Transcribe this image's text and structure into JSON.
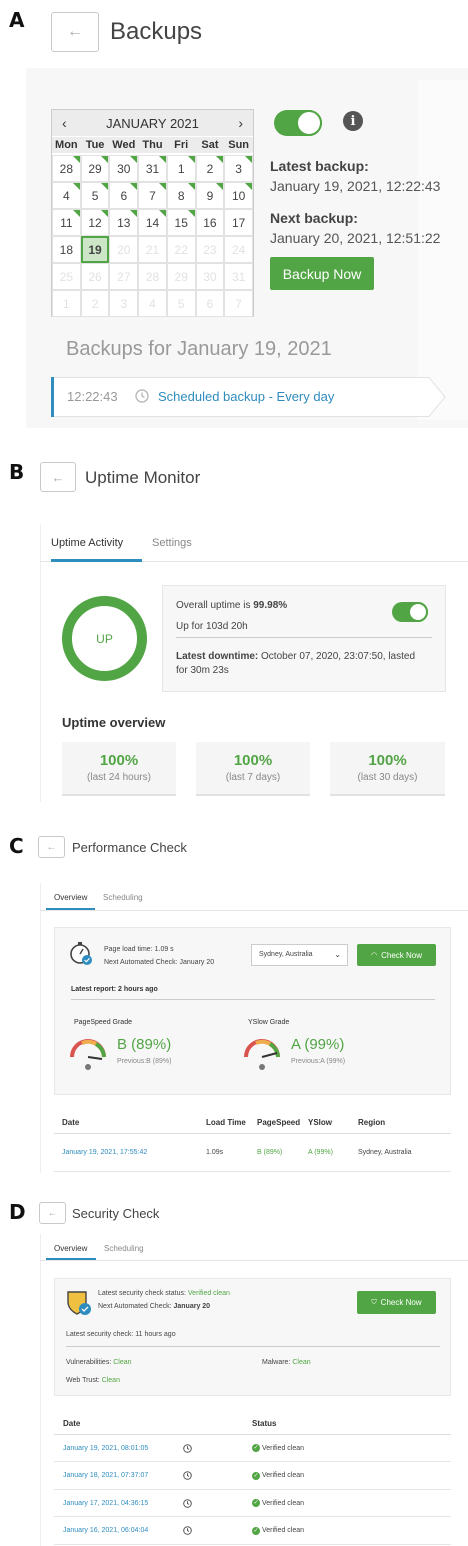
{
  "panels": {
    "a": {
      "letter": "A",
      "title": "Backups",
      "calendar": {
        "month_label": "JANUARY 2021",
        "prev": "‹",
        "next": "›",
        "weekdays": [
          "Mon",
          "Tue",
          "Wed",
          "Thu",
          "Fri",
          "Sat",
          "Sun"
        ],
        "days": [
          "28",
          "29",
          "30",
          "31",
          "1",
          "2",
          "3",
          "4",
          "5",
          "6",
          "7",
          "8",
          "9",
          "10",
          "11",
          "12",
          "13",
          "14",
          "15",
          "16",
          "17",
          "18",
          "19",
          "20",
          "21",
          "22",
          "23",
          "24",
          "25",
          "26",
          "27",
          "28",
          "29",
          "30",
          "31",
          "1",
          "2",
          "3",
          "4",
          "5",
          "6",
          "7"
        ],
        "selected_day": "19"
      },
      "latest_backup_label": "Latest backup:",
      "latest_backup_value": "January 19, 2021, 12:22:43",
      "next_backup_label": "Next backup:",
      "next_backup_value": "January 20, 2021, 12:51:22",
      "backup_now": "Backup Now",
      "backups_for": "Backups for January 19, 2021",
      "entry_time": "12:22:43",
      "entry_label": "Scheduled backup - Every day",
      "toggle_on": true
    },
    "b": {
      "letter": "B",
      "title": "Uptime Monitor",
      "tabs": [
        "Uptime Activity",
        "Settings"
      ],
      "status": "UP",
      "overall_prefix": "Overall uptime is ",
      "overall_value": "99.98%",
      "up_for": "Up for 103d 20h",
      "latest_downtime_label": "Latest downtime:",
      "latest_downtime_value": "October 07, 2020, 23:07:50, lasted for 30m 23s",
      "overview_title": "Uptime overview",
      "overview": [
        {
          "value": "100%",
          "label": "(last 24 hours)"
        },
        {
          "value": "100%",
          "label": "(last 7 days)"
        },
        {
          "value": "100%",
          "label": "(last 30 days)"
        }
      ]
    },
    "c": {
      "letter": "C",
      "title": "Performance Check",
      "tabs": [
        "Overview",
        "Scheduling"
      ],
      "page_load_label": "Page load time:",
      "page_load_value": "1.09 s",
      "next_check_label": "Next Automated Check:",
      "next_check_value": "January 20",
      "region_select": "Sydney, Australia",
      "check_now": "Check Now",
      "latest_report": "Latest report: 2 hours ago",
      "pagespeed_title": "PageSpeed Grade",
      "pagespeed_grade": "B (89%)",
      "pagespeed_prev": "Previous:B (89%)",
      "yslow_title": "YSlow Grade",
      "yslow_grade": "A (99%)",
      "yslow_prev": "Previous:A (99%)",
      "table_headers": [
        "Date",
        "Load Time",
        "PageSpeed",
        "YSlow",
        "Region"
      ],
      "table_rows": [
        {
          "date": "January 19, 2021, 17:55:42",
          "load": "1.09s",
          "pagespeed": "B (89%)",
          "yslow": "A (99%)",
          "region": "Sydney, Australia"
        }
      ]
    },
    "d": {
      "letter": "D",
      "title": "Security Check",
      "tabs": [
        "Overview",
        "Scheduling"
      ],
      "status_label": "Latest security check status:",
      "status_value": "Verified clean",
      "next_check_label": "Next Automated Check:",
      "next_check_value": "January 20",
      "check_now": "Check Now",
      "latest_check": "Latest security check: 11 hours ago",
      "vulnerabilities_label": "Vulnerabilities:",
      "vulnerabilities_value": "Clean",
      "malware_label": "Malware:",
      "malware_value": "Clean",
      "webtrust_label": "Web Trust:",
      "webtrust_value": "Clean",
      "table_headers": [
        "Date",
        "Status"
      ],
      "table_rows": [
        {
          "date": "January 19, 2021, 08:01:05",
          "status": "Verified clean"
        },
        {
          "date": "January 18, 2021, 07:37:07",
          "status": "Verified clean"
        },
        {
          "date": "January 17, 2021, 04:36:15",
          "status": "Verified clean"
        },
        {
          "date": "January 16, 2021, 06:04:04",
          "status": "Verified clean"
        }
      ]
    }
  },
  "colors": {
    "accent_green": "#52a545",
    "link_blue": "#2f8cbf"
  },
  "icons": [
    "back-arrow-icon",
    "info-icon",
    "clock-icon",
    "stopwatch-icon",
    "gauge-icon",
    "shield-icon",
    "check-circle-icon",
    "chevron-down-icon"
  ]
}
